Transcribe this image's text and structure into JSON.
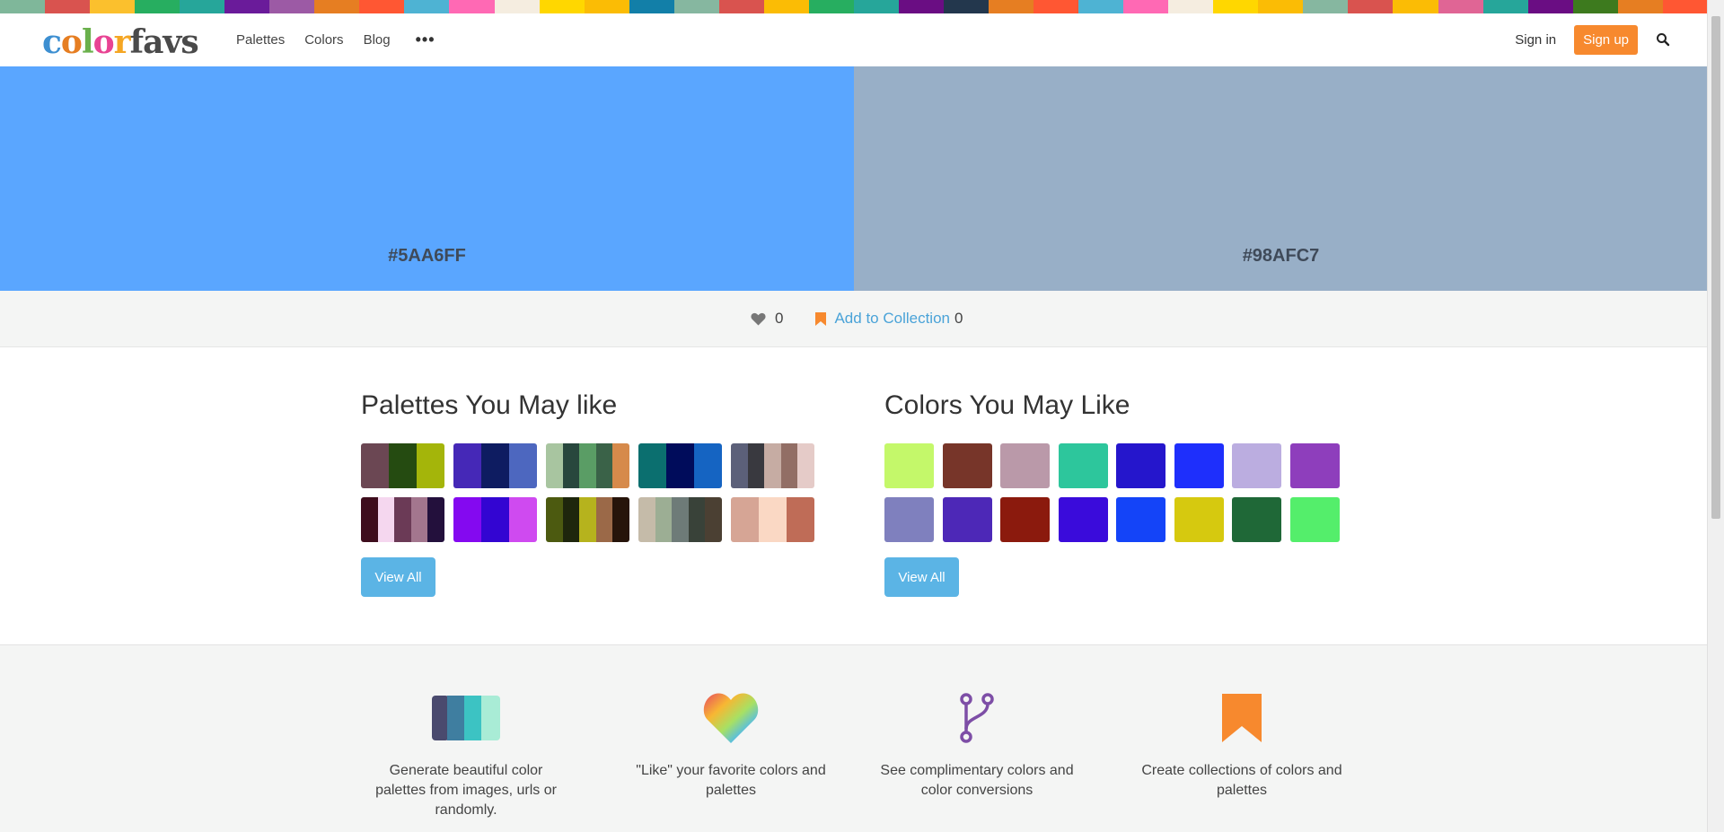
{
  "top_stripe_colors": [
    "#7fb79a",
    "#d9534f",
    "#fbc02d",
    "#27ae60",
    "#26a69a",
    "#6a1b9a",
    "#9c5aa5",
    "#e67e22",
    "#ff5733",
    "#4eb3d3",
    "#ff69b4",
    "#f5ede0",
    "#ffd700",
    "#fbbc05",
    "#127fa8",
    "#86b7a0",
    "#d9534f",
    "#fbbc05",
    "#27ae60",
    "#26a69a",
    "#6a0d83",
    "#23374d",
    "#e67e22",
    "#ff5733",
    "#4eb3d3",
    "#ff69b4",
    "#f5ede0",
    "#ffd700",
    "#fbbc05",
    "#86b7a0",
    "#d9534f",
    "#fbbc05",
    "#e06595",
    "#26a69a",
    "#6a0d83",
    "#3d7a1e",
    "#e67e22",
    "#ff5733"
  ],
  "nav": {
    "logo": {
      "letters": [
        {
          "char": "c",
          "color": "#3d8fd1"
        },
        {
          "char": "o",
          "color": "#e67e22"
        },
        {
          "char": "l",
          "color": "#6ab04c"
        },
        {
          "char": "o",
          "color": "#e84393"
        },
        {
          "char": "r",
          "color": "#f5a623"
        },
        {
          "char": "favs",
          "color": "#4a4a4a"
        }
      ]
    },
    "links": [
      "Palettes",
      "Colors",
      "Blog"
    ],
    "more": "•••",
    "sign_in": "Sign in",
    "sign_up": "Sign up",
    "accent_color": "#f7892e"
  },
  "swatches": [
    {
      "color": "#5AA6FF",
      "label": "#5AA6FF"
    },
    {
      "color": "#98AFC7",
      "label": "#98AFC7"
    }
  ],
  "actions": {
    "like_count": "0",
    "add_to_collection": "Add to Collection",
    "collection_count": "0"
  },
  "palettes_section": {
    "title": "Palettes You May like",
    "view_all": "View All",
    "palettes": [
      [
        "#6b4753",
        "#254b11",
        "#a4b50a"
      ],
      [
        "#4528b7",
        "#0e1c61",
        "#4d67bf"
      ],
      [
        "#a8c5a0",
        "#28473d",
        "#5a9d65",
        "#3a6248",
        "#d68a4b"
      ],
      [
        "#0b6f6f",
        "#000c5b",
        "#1564c2"
      ],
      [
        "#5c6079",
        "#39393f",
        "#c6aca3",
        "#926e65",
        "#e5cbc8"
      ],
      [
        "#3e0d1d",
        "#f5d7ef",
        "#6b3a56",
        "#a3768e",
        "#23103c"
      ],
      [
        "#8409f0",
        "#3305d2",
        "#cf4af0"
      ],
      [
        "#4c5a10",
        "#1e260c",
        "#b6b31d",
        "#9b6948",
        "#26140a"
      ],
      [
        "#c5bba9",
        "#9cae94",
        "#6e7b78",
        "#394239",
        "#4b4033"
      ],
      [
        "#d6a595",
        "#fad8c4",
        "#bf6c57"
      ]
    ]
  },
  "colors_section": {
    "title": "Colors You May Like",
    "view_all": "View All",
    "colors": [
      "#c4f86a",
      "#773529",
      "#ba99a9",
      "#2dc69c",
      "#2516cc",
      "#1e2ffc",
      "#bbade0",
      "#8e3ebc",
      "#7f80be",
      "#4d28b7",
      "#8b1a0d",
      "#3a0bdb",
      "#1444f8",
      "#d6c90f",
      "#1f6837",
      "#54ee6b"
    ]
  },
  "features": [
    {
      "icon": "palette-icon",
      "text": "Generate beautiful color palettes from images, urls or randomly."
    },
    {
      "icon": "rainbow-heart-icon",
      "text": "\"Like\" your favorite colors and palettes"
    },
    {
      "icon": "fork-icon",
      "text": "See complimentary colors and color conversions"
    },
    {
      "icon": "bookmark-icon",
      "text": "Create collections of colors and palettes"
    }
  ]
}
